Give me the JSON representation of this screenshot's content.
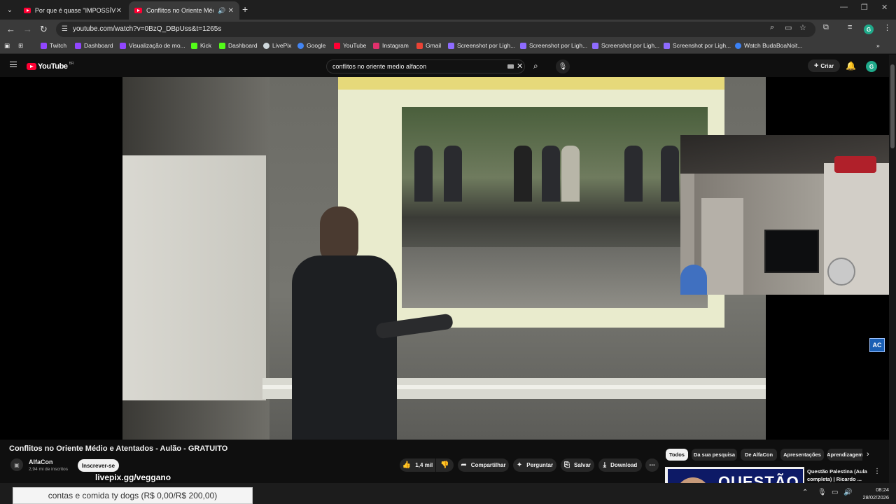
{
  "browser": {
    "tabs": [
      {
        "title": "Por que é quase \"IMPOSSÍVEL\"",
        "active": false
      },
      {
        "title": "Conflitos no Oriente Médio",
        "active": true
      }
    ],
    "url": "youtube.com/watch?v=0BzQ_DBpUss&t=1265s",
    "profile_initial": "G",
    "bookmarks": [
      {
        "label": "Twitch",
        "color": "#9146ff"
      },
      {
        "label": "Dashboard",
        "color": "#9146ff"
      },
      {
        "label": "Visualização de mo...",
        "color": "#9146ff"
      },
      {
        "label": "Kick",
        "color": "#53fc18"
      },
      {
        "label": "Dashboard",
        "color": "#53fc18"
      },
      {
        "label": "LivePix",
        "color": "#cfd8dc"
      },
      {
        "label": "Google",
        "color": "#4285f4"
      },
      {
        "label": "YouTube",
        "color": "#ff0033"
      },
      {
        "label": "Instagram",
        "color": "#e1306c"
      },
      {
        "label": "Gmail",
        "color": "#ea4335"
      },
      {
        "label": "Screenshot por Ligh...",
        "color": "#8e6bff"
      },
      {
        "label": "Screenshot por Ligh...",
        "color": "#8e6bff"
      },
      {
        "label": "Screenshot por Ligh...",
        "color": "#8e6bff"
      },
      {
        "label": "Screenshot por Ligh...",
        "color": "#8e6bff"
      },
      {
        "label": "Watch BudaBoaNoit...",
        "color": "#3b82f6"
      }
    ]
  },
  "youtube": {
    "logo_text": "YouTube",
    "country_code": "BR",
    "search_query": "conflitos no oriente medio alfacon",
    "create_label": "Criar",
    "profile_initial": "G"
  },
  "video": {
    "watermark": "AC",
    "title": "Conflitos no Oriente Médio e Atentados - Aulão - GRATUITO",
    "channel": "AlfaCon",
    "subscribers": "2,94 mi de inscritos",
    "subscribe_label": "Inscrever-se",
    "likes": "1,4 mil",
    "actions": {
      "share": "Compartilhar",
      "ask": "Perguntar",
      "save": "Salvar",
      "download": "Download"
    }
  },
  "sidebar": {
    "chips": [
      "Todos",
      "Da sua pesquisa",
      "De AlfaCon",
      "Apresentações",
      "Aprendizagem"
    ],
    "recommendation": {
      "thumb_text": "QUESTÃO",
      "title": "Questão Palestina (Aula completa) | Ricardo ..."
    }
  },
  "overlay": {
    "livepix_link": "livepix.gg/veggano",
    "donation_goal": "contas e comida ty dogs (R$ 0,00/R$ 200,00)"
  },
  "taskbar": {
    "time": "08:24",
    "date": "28/02/2026"
  }
}
